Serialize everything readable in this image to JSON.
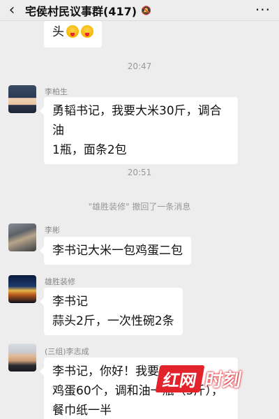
{
  "header": {
    "back_icon": "back-arrow-icon",
    "title": "宅侯村民议事群(417)",
    "mute_icon": "bell-off-icon",
    "more_icon": "more-dots-icon",
    "more_label": "···"
  },
  "messages": {
    "m0": {
      "text": "头",
      "emojis": [
        "tongue-face-emoji",
        "tongue-face-emoji"
      ]
    },
    "t1": "20:47",
    "m1": {
      "sender": "李柏生",
      "line1": "勇韬书记，我要大米30斤，调合油",
      "line2": "1瓶，面条2包"
    },
    "t2": "20:51",
    "sys": "\"雄胜装修\" 撤回了一条消息",
    "m2": {
      "sender": "李彬",
      "line1": "李书记大米一包鸡蛋二包"
    },
    "m3": {
      "sender": "雄胜装修",
      "line1": "李书记",
      "line2": "蒜头2斤，一次性碗2条"
    },
    "m4": {
      "sender": "(三组)李志成",
      "line1": "李书记，你好！我要五",
      "line2": "鸡蛋60个，调和油一瓶（5斤），",
      "line3": "餐巾纸一半"
    }
  },
  "watermark": {
    "box": "红网",
    "text": "时刻"
  }
}
